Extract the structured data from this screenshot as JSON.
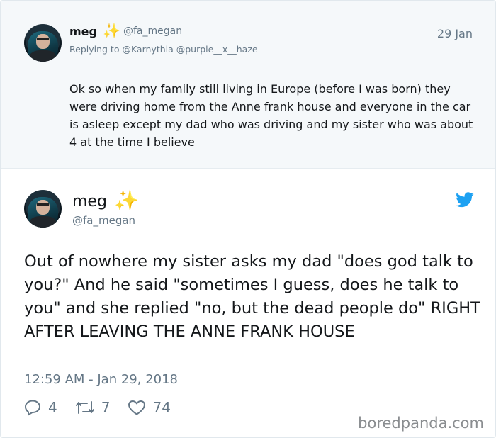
{
  "parent_tweet": {
    "name": "meg",
    "emoji": "✨",
    "handle": "@fa_megan",
    "date": "29 Jan",
    "replying_to": "Replying to @Karnythia @purple__x__haze",
    "text": "Ok so when my family still living in Europe (before I was born) they were driving home from the Anne frank house and everyone in the car is asleep except my dad who was driving and my sister who was about 4 at the time I believe"
  },
  "main_tweet": {
    "name": "meg",
    "emoji": "✨",
    "handle": "@fa_megan",
    "text": "Out of nowhere my sister asks my dad \"does god talk to you?\" And he said \"sometimes I guess, does he talk to you\" and she replied \"no, but the dead people do\" RIGHT AFTER LEAVING THE ANNE FRANK HOUSE",
    "timestamp": "12:59 AM - Jan 29, 2018",
    "replies": "4",
    "retweets": "7",
    "likes": "74"
  },
  "icons": {
    "platform": "twitter-bird-icon",
    "reply": "reply-icon",
    "retweet": "retweet-icon",
    "like": "heart-icon"
  },
  "colors": {
    "twitter_blue": "#1da1f2",
    "secondary_text": "#657786",
    "parent_bg": "#f5f8fa"
  },
  "watermark": "boredpanda.com"
}
